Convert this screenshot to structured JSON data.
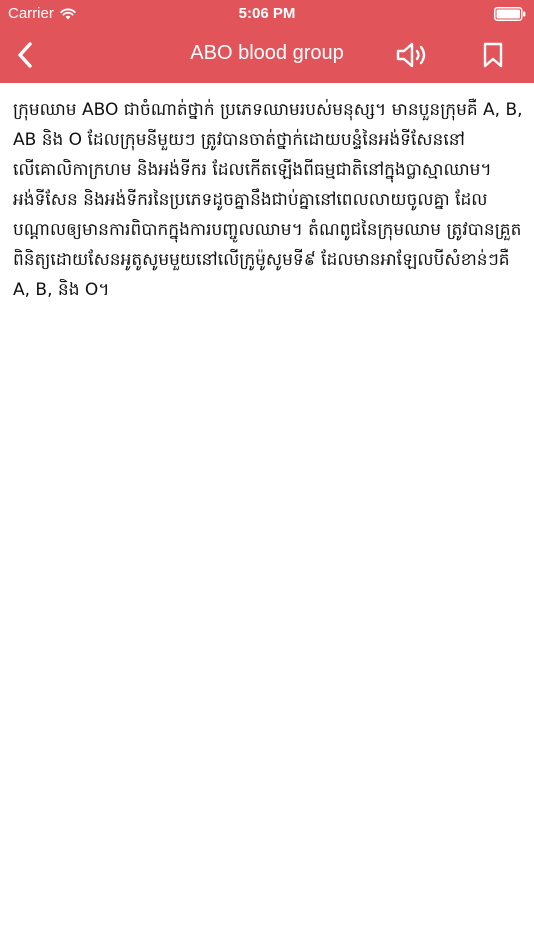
{
  "status_bar": {
    "carrier": "Carrier",
    "time": "5:06 PM",
    "wifi_icon": "wifi-icon",
    "battery_icon": "battery-icon"
  },
  "nav": {
    "title": "ABO blood group",
    "back_icon": "chevron-left-icon",
    "speaker_icon": "speaker-icon",
    "bookmark_icon": "bookmark-icon"
  },
  "article": {
    "body": "ក្រុមឈាម ABO ជាចំណាត់ថ្នាក់ ប្រភេទឈាមរបស់មនុស្ស។ មានបួនក្រុមគឺ A, B, AB និង O ដែលក្រុមនីមួយៗ ត្រូវបានចាត់ថ្នាក់ដោយបន្ទំនៃអង់ទីសែននៅលើគោលិកាក្រហម និងអង់ទីករ ដែលកើតឡើងពីធម្មជាតិនៅក្នុងប្លាស្មាឈាម។ អង់ទីសែន និងអង់ទីករនៃប្រភេទដូចគ្នានឹងជាប់គ្នានៅពេលលាយចូលគ្នា ដែលបណ្ដាលឲ្យមានការពិបាកក្នុងការបញ្ចូលឈាម។ តំណពូជនៃក្រុមឈាម ត្រូវបានគ្រួតពិនិត្យដោយសែនអូតូសូមមួយនៅលើក្រូម៉ូសូមទី៩ ដែលមានអាឡែលបីសំខាន់ៗគឺ A, B, និង O។"
  },
  "colors": {
    "header_bg": "#e0545a",
    "header_text": "#ffffff",
    "body_text": "#111111"
  }
}
